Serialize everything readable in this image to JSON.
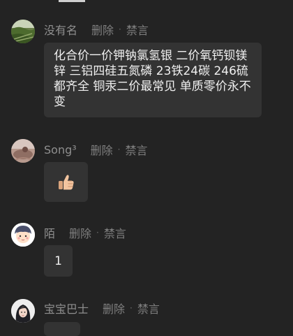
{
  "messages": [
    {
      "username": "没有名",
      "actions": {
        "delete": "删除",
        "separator": "·",
        "mute": "禁言"
      },
      "content": "化合价一价钾钠氯氢银 二价氧钙钡镁锌 三铝四硅五氮磷 23铁24碳 246硫都齐全 铜汞二价最常见 单质零价永不变"
    },
    {
      "username": "Song³",
      "actions": {
        "delete": "删除",
        "separator": "·",
        "mute": "禁言"
      },
      "content_icon": "thumbs-up-emoji"
    },
    {
      "username": "陌",
      "actions": {
        "delete": "删除",
        "separator": "·",
        "mute": "禁言"
      },
      "content": "1"
    },
    {
      "username": "宝宝巴士",
      "actions": {
        "delete": "删除",
        "separator": "·",
        "mute": "禁言"
      }
    }
  ],
  "colors": {
    "background": "#232323",
    "bubble": "#333333",
    "username": "#8f8f8f",
    "action": "#7f7f7f",
    "message_text": "#f0f0f0"
  }
}
